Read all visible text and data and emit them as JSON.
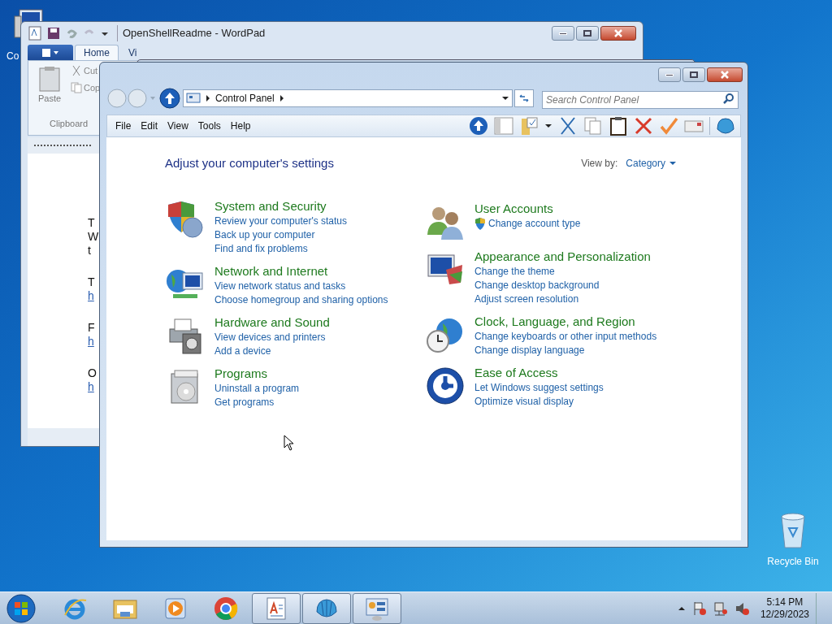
{
  "desktop": {
    "icons": [
      {
        "kind": "computer",
        "label": "Co"
      },
      {
        "kind": "recycle",
        "label": "Recycle Bin"
      }
    ]
  },
  "wordpad": {
    "title": "OpenShellReadme - WordPad",
    "tabs": [
      {
        "label": "Home",
        "selected": true
      },
      {
        "label": "Vi",
        "selected": false
      }
    ],
    "paste": "Paste",
    "cut": "Cut",
    "copy": "Cop",
    "group": "Clipboard",
    "paragraphs": [
      {
        "lines": [
          {
            "text": "T",
            "link": false
          },
          {
            "text": "W",
            "link": false
          },
          {
            "text": "t",
            "link": false
          }
        ]
      },
      {
        "lines": [
          {
            "text": "T",
            "link": false
          },
          {
            "text": "h",
            "link": true
          }
        ]
      },
      {
        "lines": [
          {
            "text": "F",
            "link": false
          },
          {
            "text": "h",
            "link": true
          }
        ]
      },
      {
        "lines": [
          {
            "text": "O",
            "link": false
          },
          {
            "text": "h",
            "link": true
          }
        ]
      }
    ]
  },
  "control_panel": {
    "breadcrumb": "Control Panel",
    "search": {
      "placeholder": "Search Control Panel"
    },
    "menu": [
      "File",
      "Edit",
      "View",
      "Tools",
      "Help"
    ],
    "heading": "Adjust your computer's settings",
    "view_by": {
      "label": "View by:",
      "value": "Category"
    },
    "columns": [
      [
        {
          "kind": "security",
          "title": "System and Security",
          "links": [
            {
              "text": "Review your computer's status",
              "shield": false
            },
            {
              "text": "Back up your computer",
              "shield": false
            },
            {
              "text": "Find and fix problems",
              "shield": false
            }
          ]
        },
        {
          "kind": "network",
          "title": "Network and Internet",
          "links": [
            {
              "text": "View network status and tasks",
              "shield": false
            },
            {
              "text": "Choose homegroup and sharing options",
              "shield": false
            }
          ]
        },
        {
          "kind": "hardware",
          "title": "Hardware and Sound",
          "links": [
            {
              "text": "View devices and printers",
              "shield": false
            },
            {
              "text": "Add a device",
              "shield": false
            }
          ]
        },
        {
          "kind": "programs",
          "title": "Programs",
          "links": [
            {
              "text": "Uninstall a program",
              "shield": false
            },
            {
              "text": "Get programs",
              "shield": false
            }
          ]
        }
      ],
      [
        {
          "kind": "users",
          "title": "User Accounts",
          "links": [
            {
              "text": "Change account type",
              "shield": true
            }
          ]
        },
        {
          "kind": "appearance",
          "title": "Appearance and Personalization",
          "links": [
            {
              "text": "Change the theme",
              "shield": false
            },
            {
              "text": "Change desktop background",
              "shield": false
            },
            {
              "text": "Adjust screen resolution",
              "shield": false
            }
          ]
        },
        {
          "kind": "clock",
          "title": "Clock, Language, and Region",
          "links": [
            {
              "text": "Change keyboards or other input methods",
              "shield": false
            },
            {
              "text": "Change display language",
              "shield": false
            }
          ]
        },
        {
          "kind": "access",
          "title": "Ease of Access",
          "links": [
            {
              "text": "Let Windows suggest settings",
              "shield": false
            },
            {
              "text": "Optimize visual display",
              "shield": false
            }
          ]
        }
      ]
    ]
  },
  "taskbar": {
    "buttons": [
      {
        "kind": "ie",
        "open": false
      },
      {
        "kind": "explorer",
        "open": false
      },
      {
        "kind": "media",
        "open": false
      },
      {
        "kind": "chrome",
        "open": false
      },
      {
        "kind": "wordpad",
        "open": true
      },
      {
        "kind": "shell",
        "open": true
      },
      {
        "kind": "controlpanel",
        "open": true
      }
    ],
    "time": "5:14 PM",
    "date": "12/29/2023"
  }
}
